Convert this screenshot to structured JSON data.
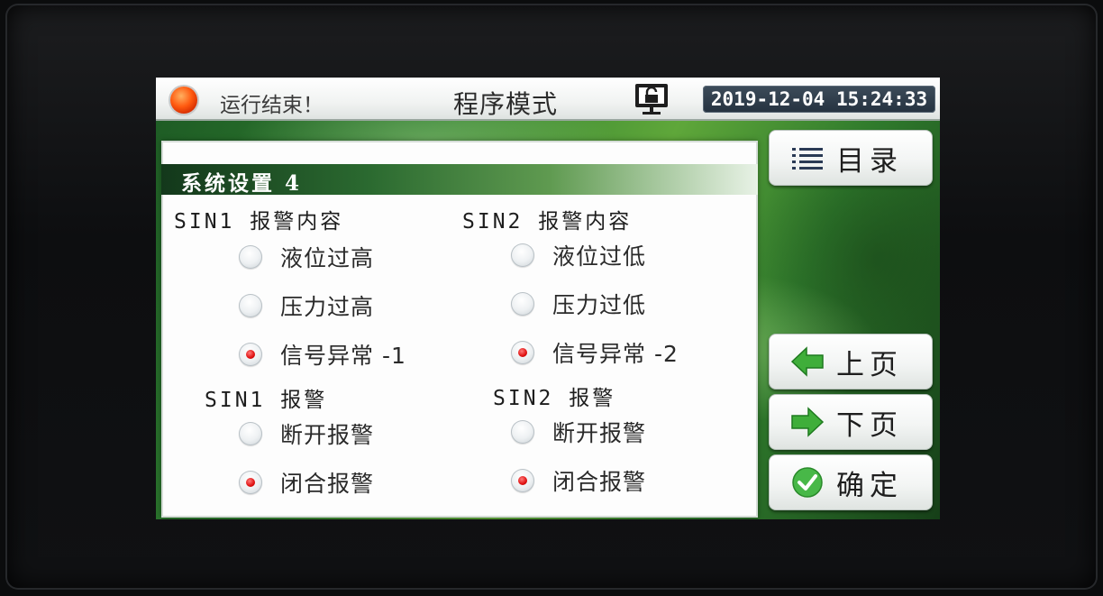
{
  "status_bar": {
    "status_text": "运行结束！",
    "mode_title": "程序模式",
    "datetime": "2019-12-04  15:24:33"
  },
  "panel": {
    "title": "系统设置 4",
    "sin1_content": {
      "label": "SIN1 报警内容",
      "options": [
        {
          "label": "液位过高",
          "selected": false
        },
        {
          "label": "压力过高",
          "selected": false
        },
        {
          "label": "信号异常 -1",
          "selected": true
        }
      ]
    },
    "sin2_content": {
      "label": "SIN2 报警内容",
      "options": [
        {
          "label": "液位过低",
          "selected": false
        },
        {
          "label": "压力过低",
          "selected": false
        },
        {
          "label": "信号异常 -2",
          "selected": true
        }
      ]
    },
    "sin1_alarm": {
      "label": "SIN1 报警",
      "options": [
        {
          "label": "断开报警",
          "selected": false
        },
        {
          "label": "闭合报警",
          "selected": true
        }
      ]
    },
    "sin2_alarm": {
      "label": "SIN2 报警",
      "options": [
        {
          "label": "断开报警",
          "selected": false
        },
        {
          "label": "闭合报警",
          "selected": true
        }
      ]
    }
  },
  "buttons": {
    "menu": "目录",
    "prev_page": "上页",
    "next_page": "下页",
    "confirm": "确定"
  },
  "colors": {
    "status_led": "#ff5a10",
    "selected_radio": "#e01010",
    "header_green": "#2b6a30"
  },
  "icons": {
    "status": "status-led-icon",
    "lock": "unlocked-monitor-icon",
    "menu": "list-icon",
    "prev": "left-arrow-icon",
    "next": "right-arrow-icon",
    "confirm": "check-icon"
  }
}
